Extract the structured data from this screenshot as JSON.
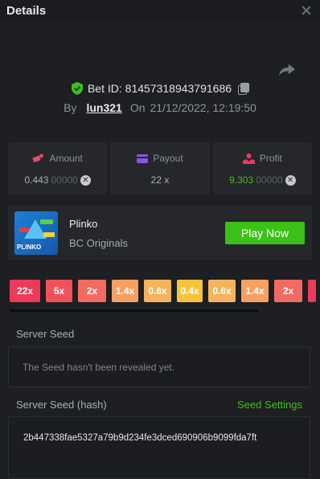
{
  "header": {
    "title": "Details"
  },
  "bet": {
    "id_label": "Bet ID: 81457318943791686",
    "by_label": "By",
    "user": "lun321",
    "on_label": "On",
    "datetime": "21/12/2022, 12:19:50"
  },
  "stats": {
    "amount": {
      "label": "Amount",
      "value_main": "0.443",
      "value_dim": "00000"
    },
    "payout": {
      "label": "Payout",
      "value": "22 x"
    },
    "profit": {
      "label": "Profit",
      "value_main": "9.303",
      "value_dim": "00000"
    }
  },
  "game": {
    "thumb_label": "PLINKO",
    "name": "Plinko",
    "provider": "BC Originals",
    "play_label": "Play Now"
  },
  "multipliers": [
    {
      "label": "22x",
      "color": "#ee3a5a",
      "width": 38
    },
    {
      "label": "5x",
      "color": "#f2515a",
      "width": 33
    },
    {
      "label": "2x",
      "color": "#f26a62",
      "width": 35
    },
    {
      "label": "1.4x",
      "color": "#f7a060",
      "width": 33
    },
    {
      "label": "0.6x",
      "color": "#f5b35b",
      "width": 34
    },
    {
      "label": "0.4x",
      "color": "#f8c33c",
      "width": 32
    },
    {
      "label": "0.6x",
      "color": "#f5b35b",
      "width": 34
    },
    {
      "label": "1.4x",
      "color": "#f7a060",
      "width": 34
    },
    {
      "label": "2x",
      "color": "#f26a62",
      "width": 35
    },
    {
      "label": "",
      "color": "#ee3a5a",
      "width": 10
    }
  ],
  "seeds": {
    "server_seed_label": "Server Seed",
    "server_seed_value": "The Seed hasn't been revealed yet.",
    "server_hash_label": "Server Seed (hash)",
    "settings_label": "Seed Settings",
    "server_hash_value": "2b447338fae5327a79b9d234fe3dced690906b9099fda7ft"
  },
  "colors": {
    "accent_green": "#3bc117",
    "background": "#1d1f22",
    "panel": "#25272b"
  }
}
